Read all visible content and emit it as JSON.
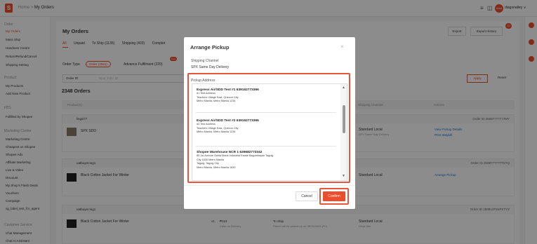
{
  "header": {
    "logo_glyph": "S",
    "home": "Home",
    "sep": " > ",
    "section": "My Orders",
    "grid_icon": "≡",
    "book_icon": "◫",
    "avatar": "shop",
    "username": "diagonalley",
    "caret": "∨"
  },
  "sidebar": {
    "groups": [
      {
        "label": "Order",
        "caret": "^",
        "items": [
          {
            "label": "My Orders",
            "active": true
          },
          {
            "label": "Mass Ship",
            "active": false
          },
          {
            "label": "Handover Centre",
            "active": false
          },
          {
            "label": "Return/Refund/Cancel",
            "active": false
          },
          {
            "label": "Shipping Setting",
            "active": false
          }
        ]
      },
      {
        "label": "Product",
        "caret": "^",
        "items": [
          {
            "label": "My Products",
            "active": false
          },
          {
            "label": "Add New Product",
            "active": false
          }
        ]
      },
      {
        "label": "FBS",
        "caret": "^",
        "items": [
          {
            "label": "Fulfilled by Shopee",
            "active": false
          }
        ]
      },
      {
        "label": "Marketing Centre",
        "caret": "^",
        "items": [
          {
            "label": "Marketing Centre",
            "active": false
          },
          {
            "label": "Cheapest on Shopee",
            "active": false
          },
          {
            "label": "Shopee Ads",
            "active": false
          },
          {
            "label": "Affiliate Marketing",
            "active": false
          },
          {
            "label": "Live & Video",
            "active": false
          },
          {
            "label": "Discount",
            "active": false
          },
          {
            "label": "My Shop's Flash Deals",
            "active": false
          },
          {
            "label": "Vouchers",
            "active": false
          },
          {
            "label": "Campaign",
            "active": false
          },
          {
            "label": "sg_label_test_for_agent",
            "active": false
          }
        ]
      },
      {
        "label": "Customer Service",
        "caret": "^",
        "items": [
          {
            "label": "Chat Management",
            "active": false
          },
          {
            "label": "Chat AI Assistant",
            "active": false
          }
        ]
      }
    ]
  },
  "main": {
    "title": "My Orders",
    "export": "Export",
    "export_history": "Export History",
    "export_badge": "10",
    "tabs": [
      {
        "label": "All",
        "on": true
      },
      {
        "label": "Unpaid",
        "on": false
      },
      {
        "label": "To Ship (1135)",
        "on": false
      },
      {
        "label": "Shipping (403)",
        "on": false
      },
      {
        "label": "Complet",
        "on": false
      }
    ],
    "order_type_label": "Order Type",
    "order_chip": "Order (2561)",
    "advance_chip": "Advance Fulfilment (220)",
    "new_badge": "New",
    "order_id_select": "Order ID",
    "order_id_placeholder": "Input order ID",
    "apply": "Apply",
    "reset": "Reset",
    "count": "2348 Orders",
    "col_product": "Product(s)",
    "col_channel": "Shipping Channel",
    "col_actions": "Actions",
    "orders": [
      {
        "buyer": "lingxi77",
        "order_id": "Order ID 2508??????7MY",
        "product": "SPX SDD",
        "channel": "Standard Local",
        "channel_sub": "SPX Same Day Delivery",
        "action1": "View Pickup Details",
        "action2": "Print Waybill"
      },
      {
        "buyer": "uatbuyer.tog1",
        "order_id": "Order ID 2508??????TSTQ",
        "product": "Black Cotton Jacket For Winter",
        "channel": "Standard Local",
        "channel_sub": "",
        "action1": "Arrange Pickup",
        "action2": ""
      },
      {
        "buyer": "uatbuyer.tog1",
        "order_id": "Order ID 250813T5SPKTYZ",
        "product": "Black Cotton Jacket For Winter",
        "qty": "x1",
        "price": "₱123",
        "pay": "Cash on Delivery",
        "status": "To Ship",
        "status_sub": "Parcel will be picked up on 08/15/2025 (Fri)",
        "channel": "Standard Local",
        "channel_sub": "Ninja Van"
      }
    ]
  },
  "modal": {
    "title": "Arrange Pickup",
    "close": "×",
    "channel_label": "Shipping Channel",
    "channel_value": "SPX Same Day Delivery",
    "address_label": "Pickup Address",
    "up_arrow": "▲",
    "down_arrow": "▼",
    "addresses": [
      {
        "name": "Express Air/SDD Test #1 639162773366",
        "l1": "#1 Test Address",
        "l2": "Teachers Village East, Quezon City",
        "l3": "Metro Manila, Metro Manila 1234",
        "l4": ""
      },
      {
        "name": "Express Air/SDD Test #2 639162773366",
        "l1": "#2 Test Address",
        "l2": "Teachers Village East, Quezon City",
        "l3": "Metro Manila, Metro Manila 1234",
        "l4": ""
      },
      {
        "name": "Shopee Warehouse NCR 1 639682773342",
        "l1": "85 1st Avenue Santa Maria Industrial Estate Bagumbayan Taguig",
        "l2": "City 1630 Metro Manila",
        "l3": "Taguig, Taguig City",
        "l4": "Metro Manila, Metro Manila 1630"
      }
    ],
    "cancel": "Cancel",
    "confirm": "Confirm"
  }
}
